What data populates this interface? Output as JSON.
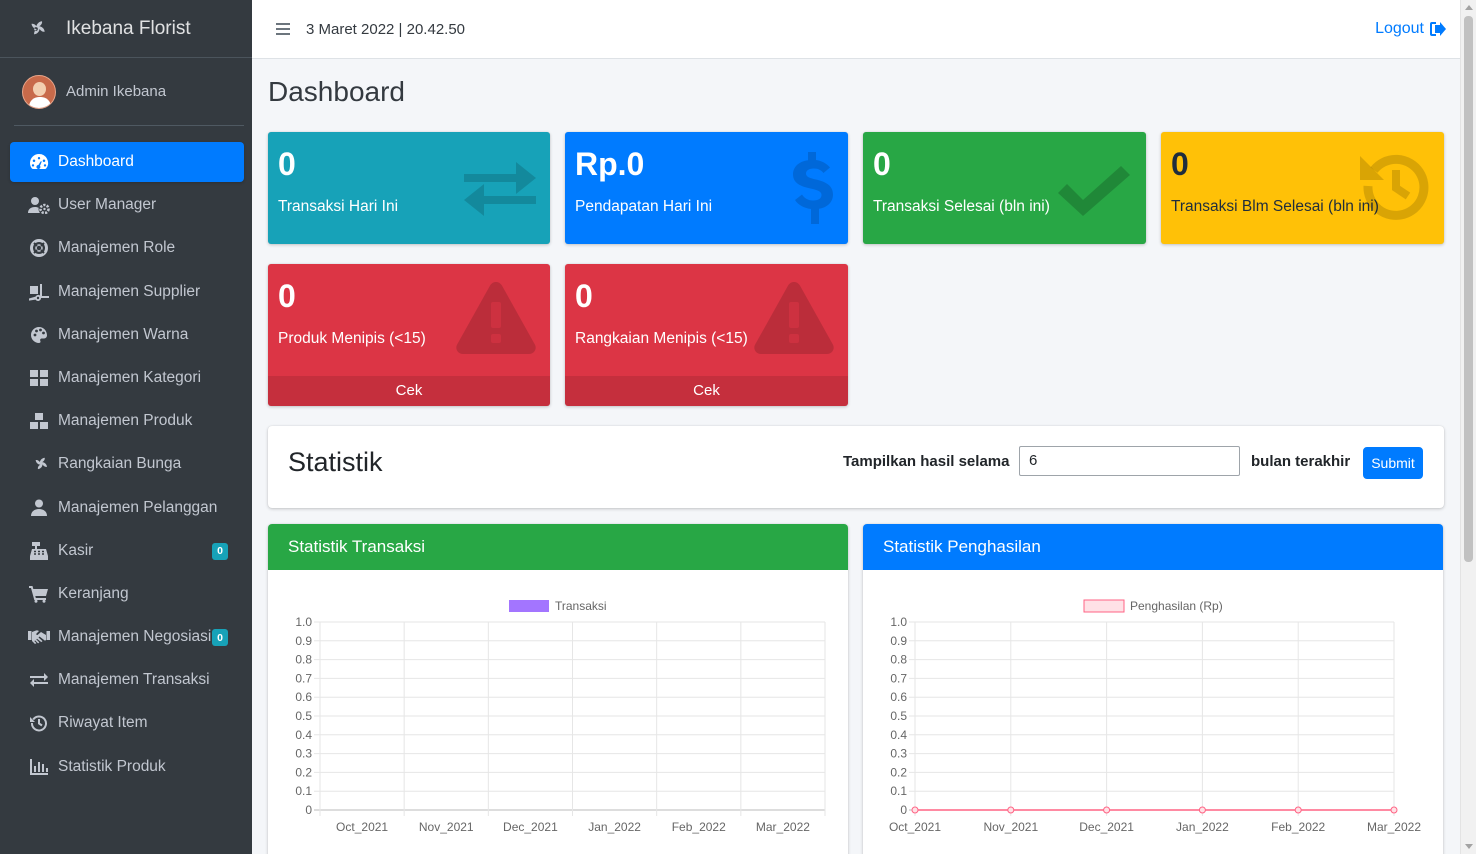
{
  "app": {
    "brand": "Ikebana Florist",
    "user": "Admin Ikebana"
  },
  "sidebar": {
    "items": [
      {
        "label": "Dashboard",
        "icon": "tachometer-icon",
        "active": true
      },
      {
        "label": "User Manager",
        "icon": "user-cog-icon"
      },
      {
        "label": "Manajemen Role",
        "icon": "life-ring-icon"
      },
      {
        "label": "Manajemen Supplier",
        "icon": "truck-loading-icon"
      },
      {
        "label": "Manajemen Warna",
        "icon": "palette-icon"
      },
      {
        "label": "Manajemen Kategori",
        "icon": "th-large-icon"
      },
      {
        "label": "Manajemen Produk",
        "icon": "cubes-icon"
      },
      {
        "label": "Rangkaian Bunga",
        "icon": "fan-icon"
      },
      {
        "label": "Manajemen Pelanggan",
        "icon": "user-icon"
      },
      {
        "label": "Kasir",
        "icon": "cash-register-icon",
        "badge": "0"
      },
      {
        "label": "Keranjang",
        "icon": "shopping-cart-icon"
      },
      {
        "label": "Manajemen Negosiasi",
        "icon": "handshake-icon",
        "badge": "0"
      },
      {
        "label": "Manajemen Transaksi",
        "icon": "exchange-icon"
      },
      {
        "label": "Riwayat Item",
        "icon": "history-icon"
      },
      {
        "label": "Statistik Produk",
        "icon": "chart-bar-icon"
      }
    ]
  },
  "topbar": {
    "datetime": "3 Maret 2022 | 20.42.50",
    "logout": "Logout"
  },
  "page": {
    "title": "Dashboard"
  },
  "boxes": [
    {
      "value": "0",
      "label": "Transaksi Hari Ini",
      "color": "#17a2b8",
      "icon": "exchange-icon"
    },
    {
      "value": "Rp.0",
      "label": "Pendapatan Hari Ini",
      "color": "#007bff",
      "icon": "dollar-icon"
    },
    {
      "value": "0",
      "label": "Transaksi Selesai (bln ini)",
      "color": "#28a745",
      "icon": "check-icon"
    },
    {
      "value": "0",
      "label": "Transaksi Blm Selesai (bln ini)",
      "color": "#ffc107",
      "icon": "history-icon"
    },
    {
      "value": "0",
      "label": "Produk Menipis (<15)",
      "color": "#dc3545",
      "icon": "warning-icon",
      "footer": "Cek"
    },
    {
      "value": "0",
      "label": "Rangkaian Menipis (<15)",
      "color": "#dc3545",
      "icon": "warning-icon",
      "footer": "Cek"
    }
  ],
  "stat_filter": {
    "title": "Statistik",
    "label_before": "Tampilkan hasil selama",
    "input_value": "6",
    "label_after": "bulan terakhir",
    "submit": "Submit"
  },
  "charts": {
    "transaksi": {
      "header": "Statistik Transaksi",
      "header_color": "#28a745"
    },
    "penghasilan": {
      "header": "Statistik Penghasilan",
      "header_color": "#007bff"
    }
  },
  "chart_data": [
    {
      "type": "bar",
      "categories": [
        "Oct_2021",
        "Nov_2021",
        "Dec_2021",
        "Jan_2022",
        "Feb_2022",
        "Mar_2022"
      ],
      "series": [
        {
          "name": "Transaksi",
          "values": [
            0,
            0,
            0,
            0,
            0,
            0
          ],
          "color": "#9966ff"
        }
      ],
      "yticks": [
        "1.0",
        "0.9",
        "0.8",
        "0.7",
        "0.6",
        "0.5",
        "0.4",
        "0.3",
        "0.2",
        "0.1",
        "0"
      ],
      "ylim": [
        0,
        1
      ],
      "grid": true,
      "legend": "top"
    },
    {
      "type": "line",
      "categories": [
        "Oct_2021",
        "Nov_2021",
        "Dec_2021",
        "Jan_2022",
        "Feb_2022",
        "Mar_2022"
      ],
      "series": [
        {
          "name": "Penghasilan (Rp)",
          "values": [
            0,
            0,
            0,
            0,
            0,
            0
          ],
          "color": "#ff6384"
        }
      ],
      "yticks": [
        "1.0",
        "0.9",
        "0.8",
        "0.7",
        "0.6",
        "0.5",
        "0.4",
        "0.3",
        "0.2",
        "0.1",
        "0"
      ],
      "ylim": [
        0,
        1
      ],
      "grid": true,
      "legend": "top"
    }
  ]
}
